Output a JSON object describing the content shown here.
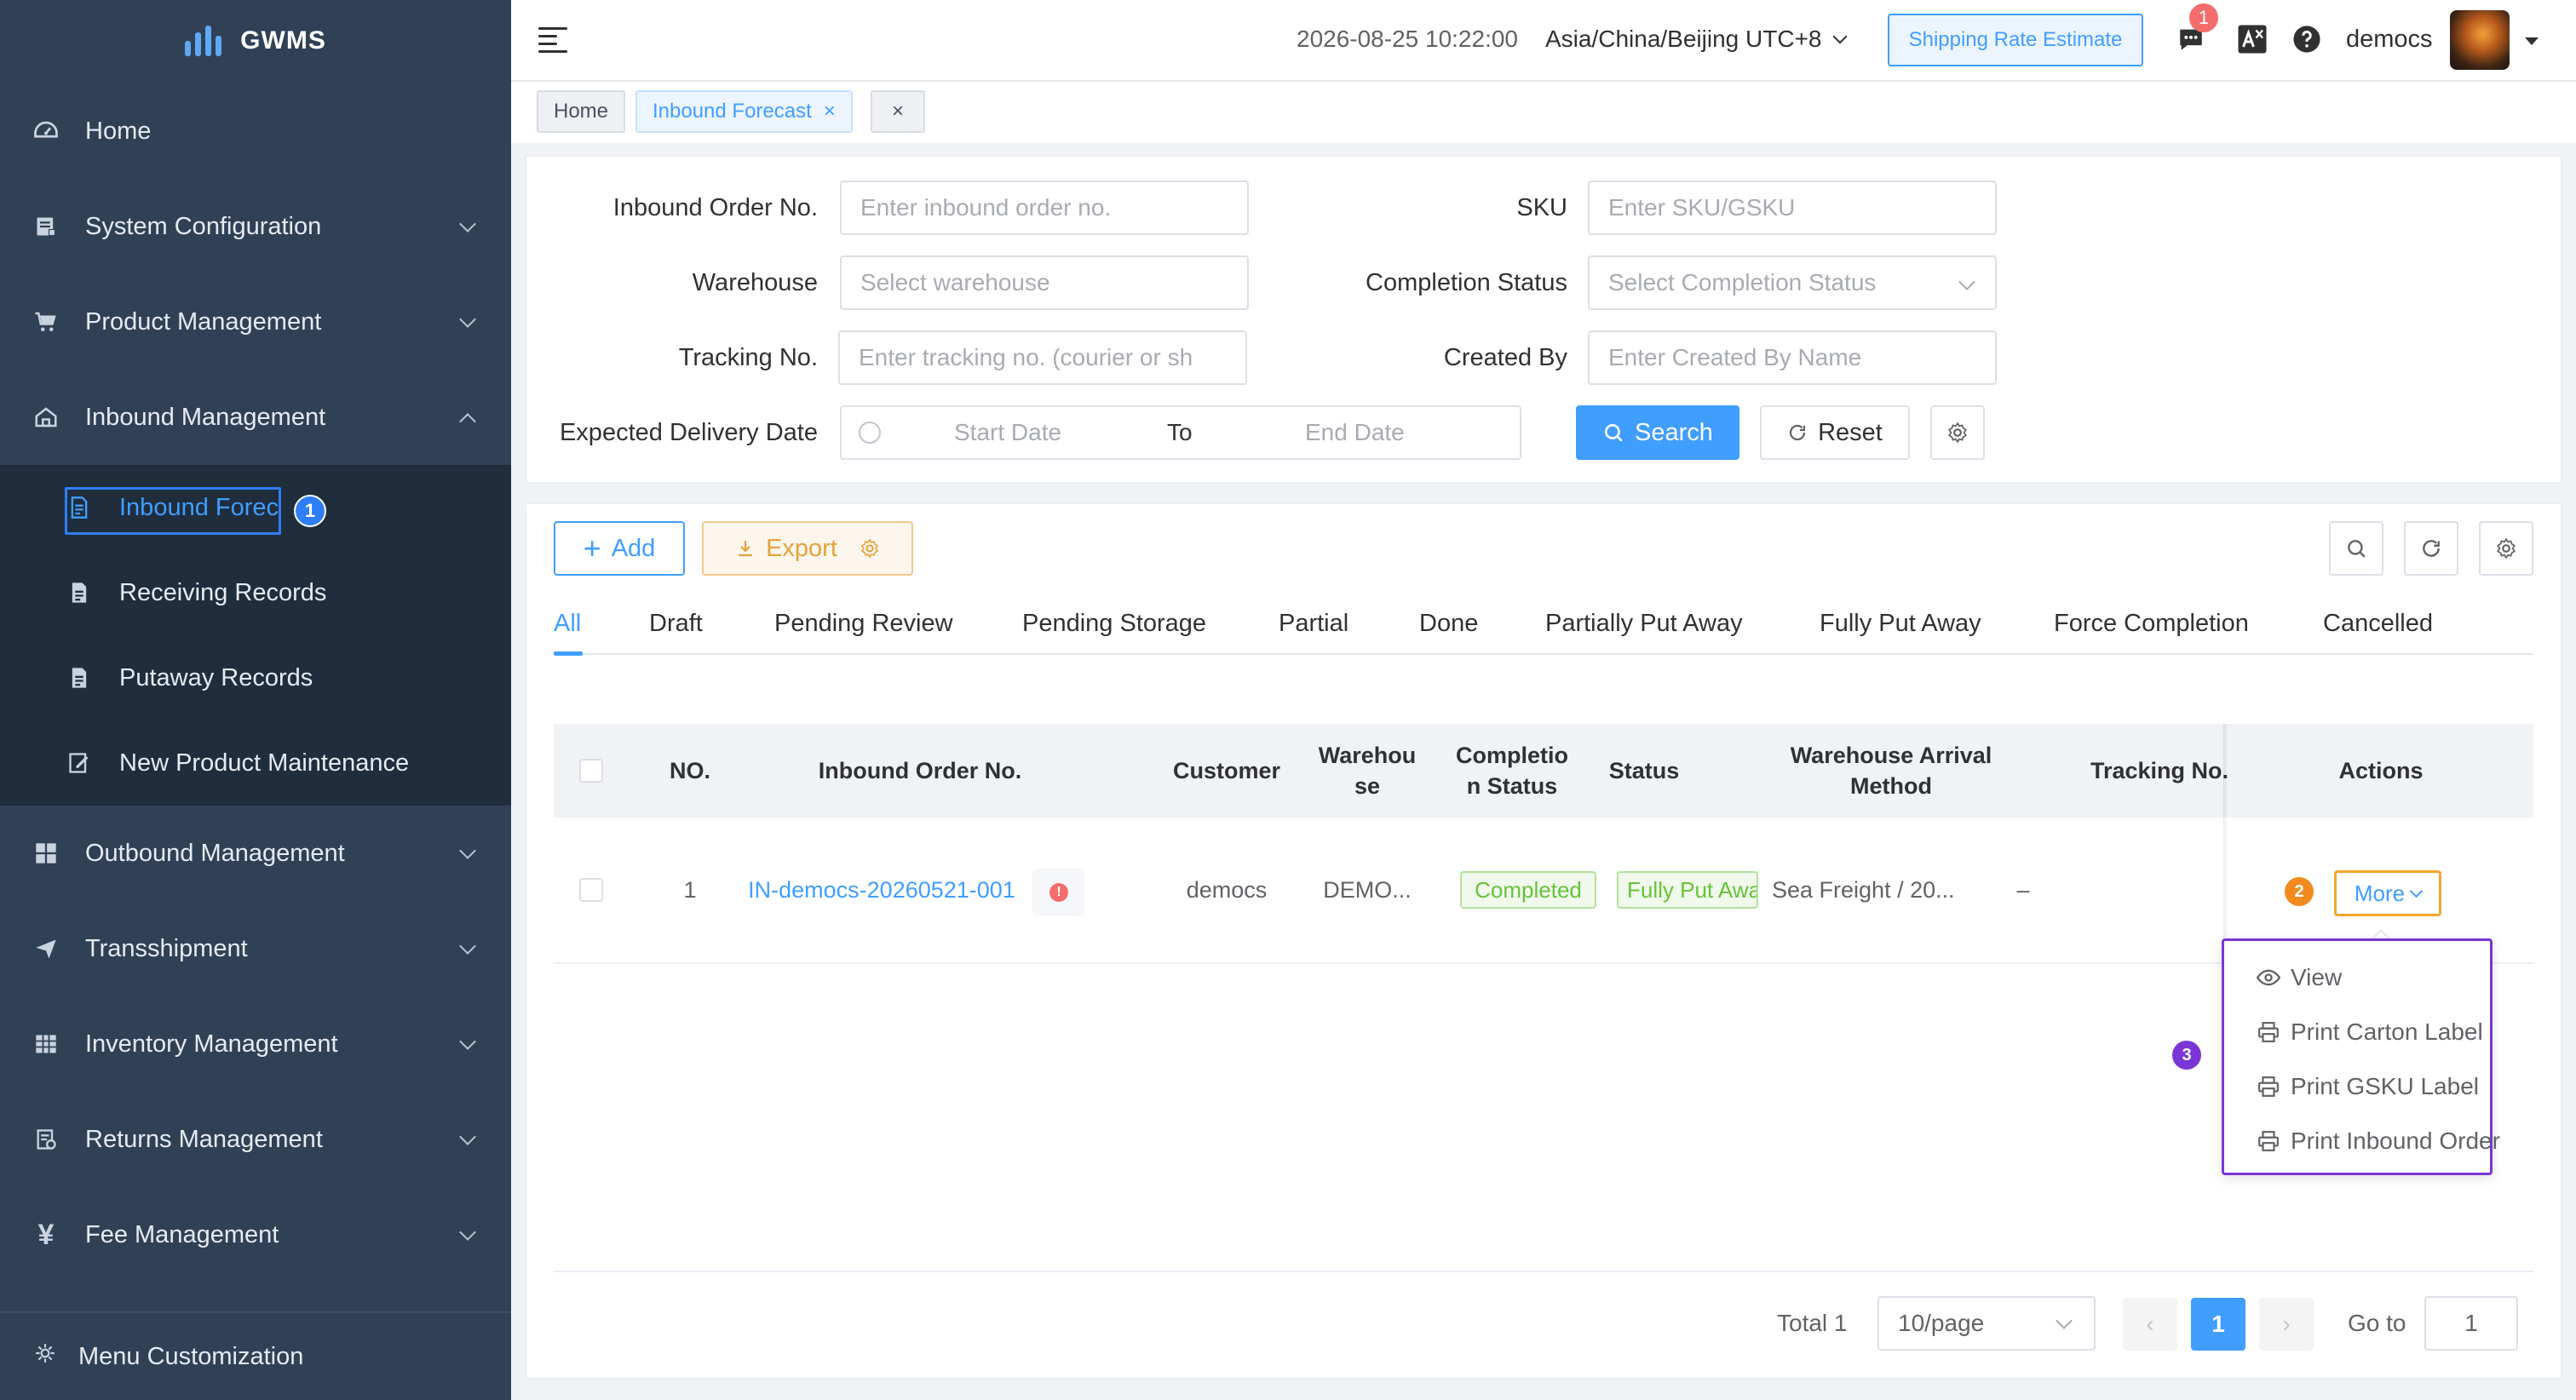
{
  "app": {
    "logo_text": "GWMS"
  },
  "sidebar": {
    "items": [
      {
        "label": "Home",
        "icon": "dashboard-icon"
      },
      {
        "label": "System Configuration",
        "icon": "server-icon"
      },
      {
        "label": "Product Management",
        "icon": "cart-icon"
      },
      {
        "label": "Inbound Management",
        "icon": "home-icon"
      },
      {
        "label": "Outbound Management",
        "icon": "grid-icon"
      },
      {
        "label": "Transshipment",
        "icon": "send-icon"
      },
      {
        "label": "Inventory Management",
        "icon": "table-icon"
      },
      {
        "label": "Returns Management",
        "icon": "returns-icon"
      },
      {
        "label": "Fee Management",
        "icon": "yen-icon"
      }
    ],
    "submenu": [
      {
        "label": "Inbound Forecast",
        "icon": "document-icon"
      },
      {
        "label": "Receiving Records",
        "icon": "document-icon"
      },
      {
        "label": "Putaway Records",
        "icon": "document-icon"
      },
      {
        "label": "New Product Maintenance",
        "icon": "edit-icon"
      }
    ],
    "menu_customization": "Menu Customization"
  },
  "header": {
    "datetime": "2026-08-25 10:22:00",
    "timezone": "Asia/China/Beijing UTC+8",
    "rate_button": "Shipping Rate Estimate",
    "message_count": "1",
    "username": "democs"
  },
  "tabs": {
    "home": "Home",
    "current": "Inbound Forecast"
  },
  "filters": {
    "inbound_order_label": "Inbound Order No.",
    "inbound_order_placeholder": "Enter inbound order no.",
    "sku_label": "SKU",
    "sku_placeholder": "Enter SKU/GSKU",
    "warehouse_label": "Warehouse",
    "warehouse_placeholder": "Select warehouse",
    "completion_label": "Completion Status",
    "completion_placeholder": "Select Completion Status",
    "tracking_label": "Tracking No.",
    "tracking_placeholder": "Enter tracking no. (courier or sh",
    "created_by_label": "Created By",
    "created_by_placeholder": "Enter Created By Name",
    "delivery_label": "Expected Delivery Date",
    "start_date": "Start Date",
    "to": "To",
    "end_date": "End Date",
    "search": "Search",
    "reset": "Reset"
  },
  "toolbar": {
    "add": "Add",
    "export": "Export"
  },
  "status_tabs": [
    "All",
    "Draft",
    "Pending Review",
    "Pending Storage",
    "Partial",
    "Done",
    "Partially Put Away",
    "Fully Put Away",
    "Force Completion",
    "Cancelled"
  ],
  "table": {
    "columns": {
      "no": "NO.",
      "order_no": "Inbound Order No.",
      "customer": "Customer",
      "warehouse": "Warehou se",
      "completion": "Completio n Status",
      "status": "Status",
      "arrival": "Warehouse Arrival Method",
      "tracking": "Tracking No.",
      "actions": "Actions"
    },
    "rows": [
      {
        "no": "1",
        "order_no": "IN-democs-20260521-001",
        "customer": "democs",
        "warehouse": "DEMO...",
        "completion": "Completed",
        "status": "Fully Put Away",
        "arrival": "Sea Freight / 20...",
        "tracking": "–",
        "more": "More"
      }
    ]
  },
  "dropdown": [
    "View",
    "Print Carton Label",
    "Print GSKU Label",
    "Print Inbound Order"
  ],
  "annotations": {
    "step1": "1",
    "step2": "2",
    "step3": "3"
  },
  "pagination": {
    "total": "Total 1",
    "page_size": "10/page",
    "current_page": "1",
    "goto_label": "Go to",
    "goto_value": "1"
  },
  "colors": {
    "primary": "#409eff",
    "sidebar": "#304156",
    "success": "#67c23a",
    "warning": "#e6a23c",
    "highlight_purple": "#7a35d6",
    "highlight_orange": "#f5a52e"
  }
}
